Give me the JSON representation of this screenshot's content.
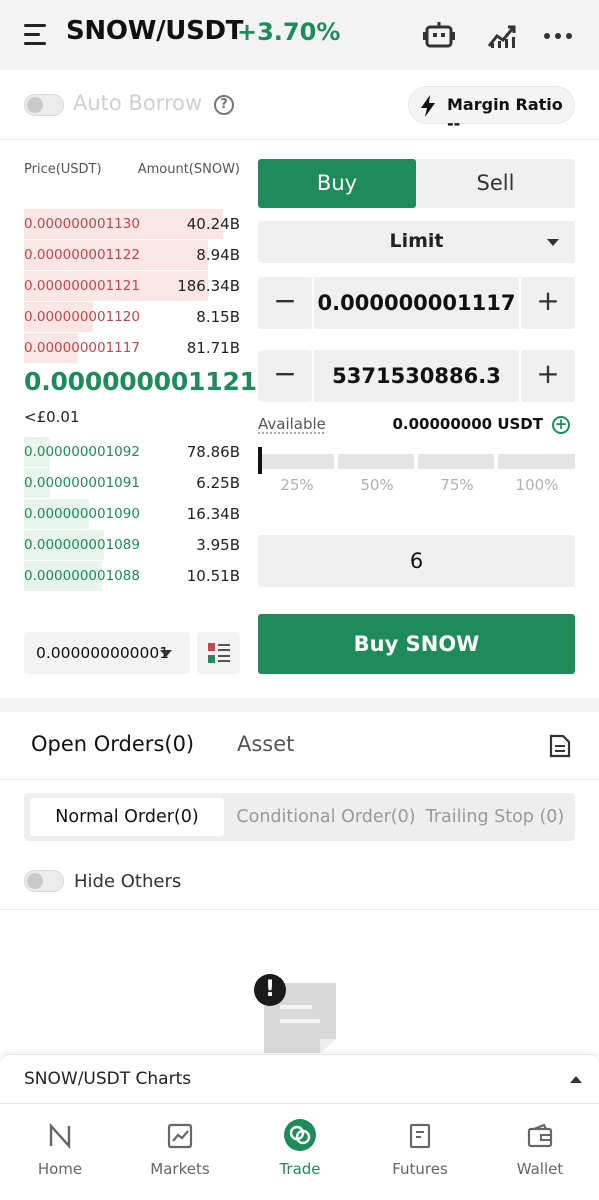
{
  "header": {
    "pair": "SNOW/USDT",
    "change": "+3.70%",
    "icons": [
      "menu-icon",
      "robot-icon",
      "chart-icon",
      "more-icon"
    ]
  },
  "borrow": {
    "auto_borrow_label": "Auto Borrow",
    "auto_borrow_enabled": false,
    "help_icon": "?",
    "margin_ratio_label": "Margin Ratio --"
  },
  "orderbook": {
    "price_header": "Price(USDT)",
    "amount_header": "Amount(SNOW)",
    "asks": [
      {
        "price": "0.000000001130",
        "amount": "40.24B",
        "depth": 0.92
      },
      {
        "price": "0.000000001122",
        "amount": "8.94B",
        "depth": 0.85
      },
      {
        "price": "0.000000001121",
        "amount": "186.34B",
        "depth": 0.85
      },
      {
        "price": "0.000000001120",
        "amount": "8.15B",
        "depth": 0.32
      },
      {
        "price": "0.000000001117",
        "amount": "81.71B",
        "depth": 0.25
      }
    ],
    "last_price": "0.000000001121",
    "fiat_price": "<£0.01",
    "bids": [
      {
        "price": "0.000000001092",
        "amount": "78.86B",
        "depth": 0.12
      },
      {
        "price": "0.000000001091",
        "amount": "6.25B",
        "depth": 0.12
      },
      {
        "price": "0.000000001090",
        "amount": "16.34B",
        "depth": 0.3
      },
      {
        "price": "0.000000001089",
        "amount": "3.95B",
        "depth": 0.37
      },
      {
        "price": "0.000000001088",
        "amount": "10.51B",
        "depth": 0.36
      }
    ],
    "precision": "0.000000000001"
  },
  "form": {
    "buy_tab": "Buy",
    "sell_tab": "Sell",
    "order_type": "Limit",
    "price_value": "0.000000001117",
    "amount_value": "5371530886.3",
    "minus": "−",
    "plus": "+",
    "available_label": "Available",
    "available_value": "0.00000000 USDT",
    "slider_position": 0,
    "slider_labels": [
      "25%",
      "50%",
      "75%",
      "100%"
    ],
    "total_value": "6",
    "submit_label": "Buy SNOW"
  },
  "orders": {
    "tab_open": "Open Orders(0)",
    "tab_asset": "Asset",
    "sub_normal": "Normal Order(0)",
    "sub_conditional": "Conditional Order(0)",
    "sub_trailing": "Trailing Stop (0)",
    "hide_others_label": "Hide Others",
    "empty_alert": "!"
  },
  "charts_bar": {
    "label": "SNOW/USDT Charts"
  },
  "nav": {
    "items": [
      {
        "label": "Home",
        "icon": "home-icon"
      },
      {
        "label": "Markets",
        "icon": "markets-icon"
      },
      {
        "label": "Trade",
        "icon": "trade-icon"
      },
      {
        "label": "Futures",
        "icon": "futures-icon"
      },
      {
        "label": "Wallet",
        "icon": "wallet-icon"
      }
    ],
    "active": "Trade"
  },
  "colors": {
    "green": "#1e8b5a",
    "red": "#c0484a",
    "ask_depth": "#fbe6e6",
    "bid_depth": "#e7f5ec"
  }
}
